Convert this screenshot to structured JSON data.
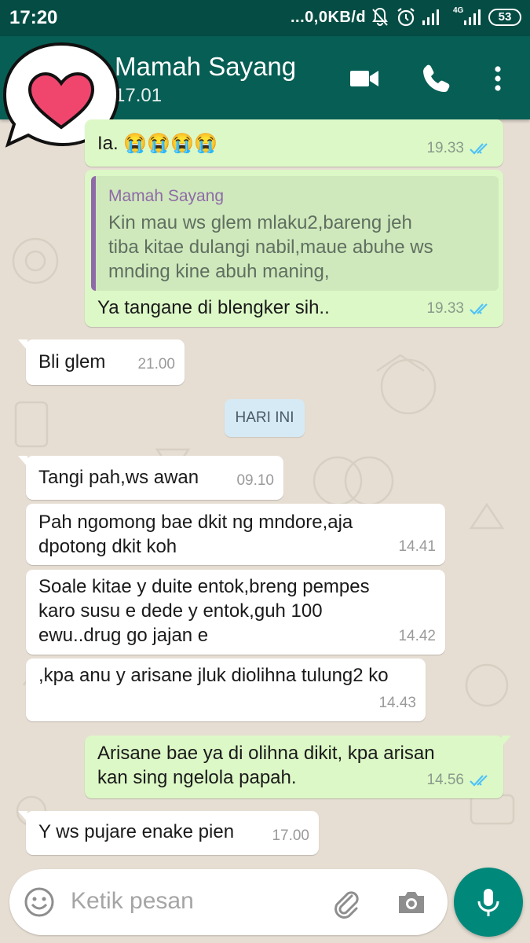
{
  "status_bar": {
    "time": "17:20",
    "network": "...0,0KB/d",
    "lte": "4G",
    "battery": "53"
  },
  "header": {
    "contact_name": "Mamah Sayang",
    "contact_status": "17.01",
    "icons": [
      "back-arrow-icon",
      "video-call-icon",
      "phone-icon",
      "more-vert-icon"
    ]
  },
  "sticker": {
    "icon": "heart-speech-bubble-icon",
    "heart_color": "#f0466e"
  },
  "messages": [
    {
      "dir": "out",
      "text": "Ia. 😭😭😭😭",
      "time": "19.33",
      "read": true
    },
    {
      "dir": "out",
      "quote_author": "Mamah Sayang",
      "quote_lines": [
        "Kin mau ws glem mlaku2,bareng jeh",
        "tiba kitae dulangi nabil,maue abuhe ws",
        "mnding kine abuh maning,"
      ],
      "text": "Ya tangane di blengker sih..",
      "time": "19.33",
      "read": true
    },
    {
      "dir": "in",
      "text": "Bli glem",
      "time": "21.00"
    },
    {
      "dir": "in",
      "text": "Tangi pah,ws awan",
      "time": "09.10"
    },
    {
      "dir": "in",
      "lines": [
        "Pah ngomong bae dkit ng mndore,aja",
        "dpotong dkit koh"
      ],
      "time": "14.41"
    },
    {
      "dir": "in",
      "lines": [
        "Soale kitae y duite entok,breng pempes",
        "karo susu e dede y entok,guh 100",
        "ewu..drug go jajan e"
      ],
      "time": "14.42"
    },
    {
      "dir": "in",
      "text": ",kpa anu y arisane jluk diolihna tulung2 ko",
      "time": "14.43"
    },
    {
      "dir": "out",
      "lines": [
        "Arisane bae ya di olihna dikit, kpa arisan",
        "kan sing ngelola papah."
      ],
      "time": "14.56",
      "read": true
    },
    {
      "dir": "in",
      "text": "Y ws pujare enake pien",
      "time": "17.00"
    }
  ],
  "date_divider": "HARI INI",
  "composer": {
    "placeholder": "Ketik pesan",
    "icons": [
      "emoji-icon",
      "attachment-icon",
      "camera-icon",
      "mic-icon"
    ]
  },
  "colors": {
    "header": "#075e54",
    "status_bar": "#054d44",
    "outgoing_bubble": "#dcf8c6",
    "incoming_bubble": "#ffffff",
    "read_ticks": "#4fc3f7",
    "accent_fab": "#00897b",
    "quote_bar": "#8f6aa8"
  }
}
